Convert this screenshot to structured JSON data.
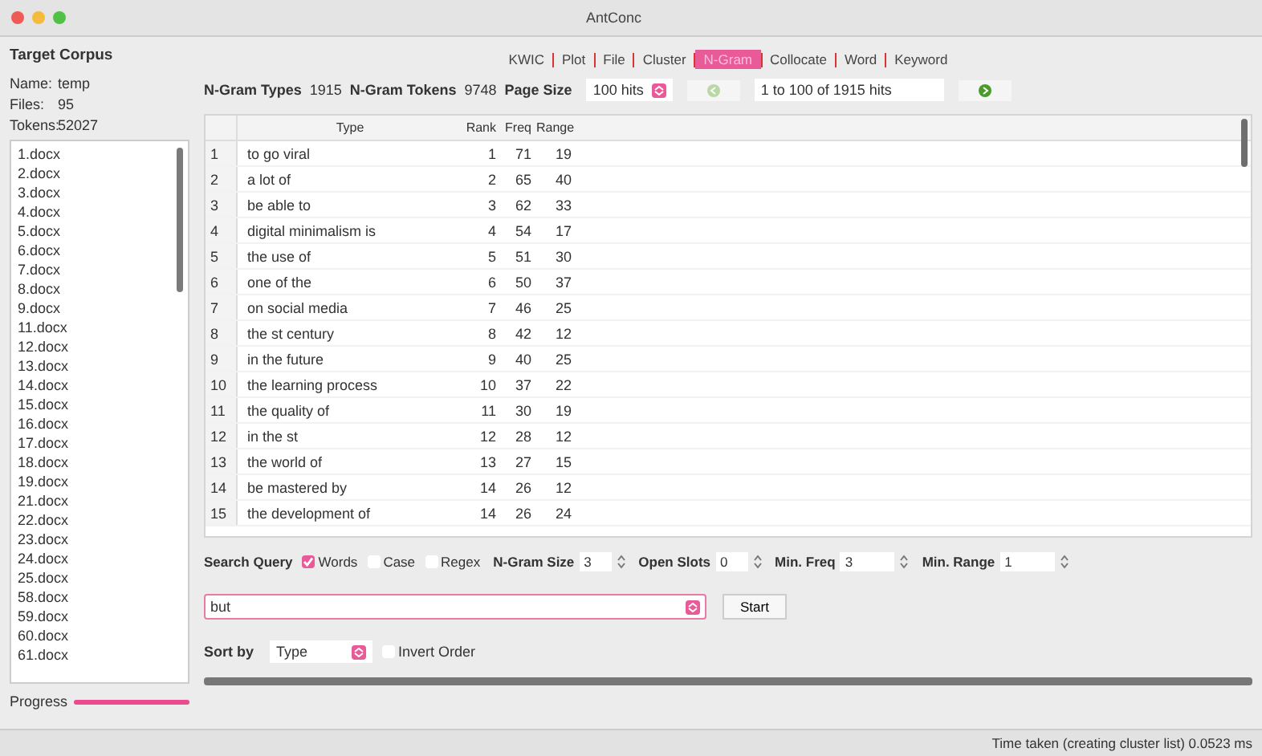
{
  "window": {
    "title": "AntConc"
  },
  "corpus": {
    "heading": "Target Corpus",
    "info": [
      {
        "label": "Name:",
        "value": "temp"
      },
      {
        "label": "Files:",
        "value": "95"
      },
      {
        "label": "Tokens:",
        "value": "52027"
      }
    ],
    "files": [
      "1.docx",
      "2.docx",
      "3.docx",
      "4.docx",
      "5.docx",
      "6.docx",
      "7.docx",
      "8.docx",
      "9.docx",
      "11.docx",
      "12.docx",
      "13.docx",
      "14.docx",
      "15.docx",
      "16.docx",
      "17.docx",
      "18.docx",
      "19.docx",
      "21.docx",
      "22.docx",
      "23.docx",
      "24.docx",
      "25.docx",
      "58.docx",
      "59.docx",
      "60.docx",
      "61.docx"
    ]
  },
  "progress": {
    "label": "Progress"
  },
  "tabs": [
    {
      "label": "KWIC",
      "selected": false
    },
    {
      "label": "Plot",
      "selected": false
    },
    {
      "label": "File",
      "selected": false
    },
    {
      "label": "Cluster",
      "selected": false
    },
    {
      "label": "N-Gram",
      "selected": true
    },
    {
      "label": "Collocate",
      "selected": false
    },
    {
      "label": "Word",
      "selected": false
    },
    {
      "label": "Keyword",
      "selected": false
    }
  ],
  "stats": {
    "types_label": "N-Gram Types",
    "types": "1915",
    "tokens_label": "N-Gram Tokens",
    "tokens": "9748",
    "page_size_label": "Page Size",
    "page_size": "100 hits",
    "hits": "1 to 100 of 1915 hits"
  },
  "table": {
    "columns": [
      "",
      "Type",
      "Rank",
      "Freq",
      "Range"
    ],
    "rows": [
      [
        "1",
        "to go viral",
        "1",
        "71",
        "19"
      ],
      [
        "2",
        "a lot of",
        "2",
        "65",
        "40"
      ],
      [
        "3",
        "be able to",
        "3",
        "62",
        "33"
      ],
      [
        "4",
        "digital minimalism is",
        "4",
        "54",
        "17"
      ],
      [
        "5",
        "the use of",
        "5",
        "51",
        "30"
      ],
      [
        "6",
        "one of the",
        "6",
        "50",
        "37"
      ],
      [
        "7",
        "on social media",
        "7",
        "46",
        "25"
      ],
      [
        "8",
        "the st century",
        "8",
        "42",
        "12"
      ],
      [
        "9",
        "in the future",
        "9",
        "40",
        "25"
      ],
      [
        "10",
        "the learning process",
        "10",
        "37",
        "22"
      ],
      [
        "11",
        "the quality of",
        "11",
        "30",
        "19"
      ],
      [
        "12",
        "in the st",
        "12",
        "28",
        "12"
      ],
      [
        "13",
        "the world of",
        "13",
        "27",
        "15"
      ],
      [
        "14",
        "be mastered by",
        "14",
        "26",
        "12"
      ],
      [
        "15",
        "the development of",
        "14",
        "26",
        "24"
      ]
    ]
  },
  "search": {
    "label": "Search Query",
    "options": [
      {
        "label": "Words",
        "checked": true
      },
      {
        "label": "Case",
        "checked": false
      },
      {
        "label": "Regex",
        "checked": false
      }
    ],
    "params": [
      {
        "label": "N-Gram Size",
        "value": "3"
      },
      {
        "label": "Open Slots",
        "value": "0"
      },
      {
        "label": "Min. Freq",
        "value": "3"
      },
      {
        "label": "Min. Range",
        "value": "1"
      }
    ],
    "query": "but",
    "start": "Start"
  },
  "sort": {
    "label": "Sort by",
    "value": "Type",
    "invert": {
      "label": "Invert Order",
      "checked": false
    }
  },
  "status_bar": "Time taken (creating cluster list) 0.0523 ms"
}
